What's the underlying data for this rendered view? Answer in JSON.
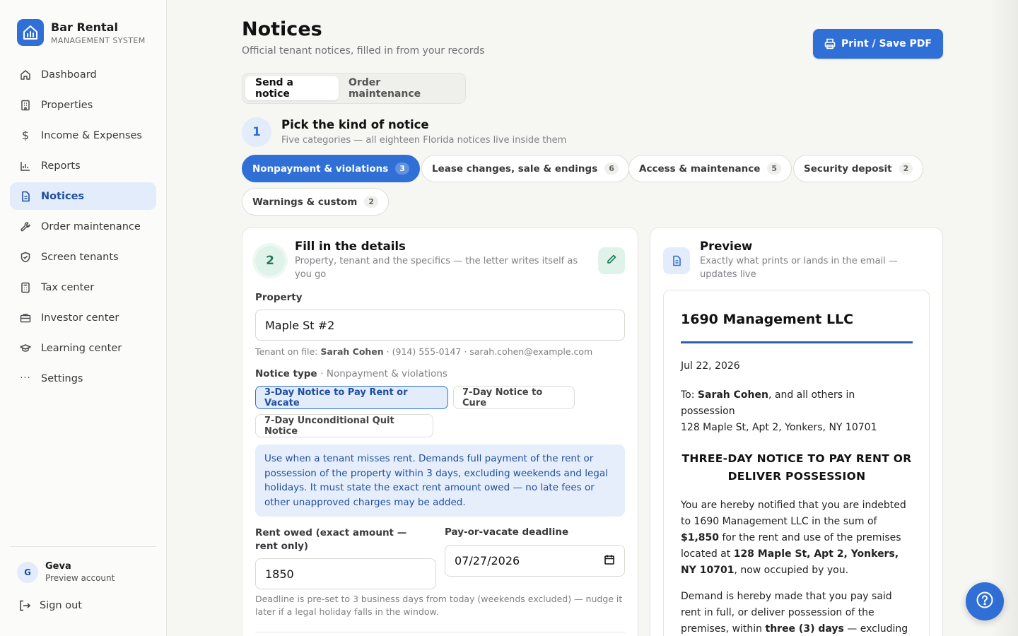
{
  "brand": {
    "name": "Bar Rental",
    "subtitle": "MANAGEMENT SYSTEM"
  },
  "sidebar": {
    "items": [
      {
        "label": "Dashboard",
        "icon": "home-icon"
      },
      {
        "label": "Properties",
        "icon": "building-icon"
      },
      {
        "label": "Income & Expenses",
        "icon": "dollar-icon"
      },
      {
        "label": "Reports",
        "icon": "bar-chart-icon"
      },
      {
        "label": "Notices",
        "icon": "document-icon",
        "active": true
      },
      {
        "label": "Order maintenance",
        "icon": "wrench-icon"
      },
      {
        "label": "Screen tenants",
        "icon": "shield-check-icon"
      },
      {
        "label": "Tax center",
        "icon": "calculator-icon"
      },
      {
        "label": "Investor center",
        "icon": "briefcase-icon"
      },
      {
        "label": "Learning center",
        "icon": "graduation-cap-icon"
      },
      {
        "label": "Settings",
        "icon": "more-dots-icon"
      }
    ],
    "account": {
      "initial": "G",
      "name": "Geva",
      "subtitle": "Preview account"
    },
    "signout_label": "Sign out"
  },
  "header": {
    "title": "Notices",
    "subtitle": "Official tenant notices, filled in from your records",
    "print_label": "Print / Save PDF"
  },
  "tabs": [
    {
      "label": "Send a notice",
      "active": true
    },
    {
      "label": "Order maintenance",
      "active": false
    }
  ],
  "step1": {
    "number": "1",
    "title": "Pick the kind of notice",
    "subtitle": "Five categories — all eighteen Florida notices live inside them",
    "categories": [
      {
        "label": "Nonpayment & violations",
        "count": "3",
        "active": true
      },
      {
        "label": "Lease changes, sale & endings",
        "count": "6"
      },
      {
        "label": "Access & maintenance",
        "count": "5"
      },
      {
        "label": "Security deposit",
        "count": "2"
      },
      {
        "label": "Warnings & custom",
        "count": "2"
      }
    ]
  },
  "step2": {
    "number": "2",
    "title": "Fill in the details",
    "subtitle": "Property, tenant and the specifics — the letter writes itself as you go",
    "property_label": "Property",
    "property_value": "Maple St #2",
    "tenant_prefix": "Tenant on file:",
    "tenant_name": "Sarah Cohen",
    "tenant_contact": "· (914) 555-0147 · sarah.cohen@example.com",
    "notice_type_label": "Notice type",
    "notice_type_category": "· Nonpayment & violations",
    "notice_types": [
      {
        "label": "3-Day Notice to Pay Rent or Vacate",
        "active": true
      },
      {
        "label": "7-Day Notice to Cure"
      },
      {
        "label": "7-Day Unconditional Quit Notice"
      }
    ],
    "info": "Use when a tenant misses rent. Demands full payment of the rent or possession of the property within 3 days, excluding weekends and legal holidays. It must state the exact rent amount owed — no late fees or other unapproved charges may be added.",
    "rent_label": "Rent owed (exact amount — rent only)",
    "rent_value": "1850",
    "deadline_label": "Pay-or-vacate deadline",
    "deadline_value": "07/27/2026",
    "deadline_hint": "Deadline is pre-set to 3 business days from today (weekends excluded) — nudge it later if a legal holiday falls in the window."
  },
  "preview": {
    "title": "Preview",
    "subtitle": "Exactly what prints or lands in the email — updates live",
    "company": "1690 Management LLC",
    "date": "Jul 22, 2026",
    "to_prefix": "To:",
    "to_name": "Sarah Cohen",
    "to_suffix": ", and all others in possession",
    "address": "128 Maple St, Apt 2, Yonkers, NY 10701",
    "notice_title": "THREE-DAY NOTICE TO PAY RENT OR DELIVER POSSESSION",
    "p1_a": "You are hereby notified that you are indebted to 1690 Management LLC in the sum of ",
    "p1_amount": "$1,850",
    "p1_b": " for the rent and use of the premises located at ",
    "p1_address": "128 Maple St, Apt 2, Yonkers, NY 10701",
    "p1_c": ", now occupied by you.",
    "p2_a": "Demand is hereby made that you pay said rent in full, or deliver possession of the premises, within ",
    "p2_days": "three (3) days",
    "p2_b": " — excluding"
  },
  "colors": {
    "accent": "#2f6fd6",
    "active_nav_bg": "#e3ecfa",
    "step2_green": "#1f7a55"
  }
}
